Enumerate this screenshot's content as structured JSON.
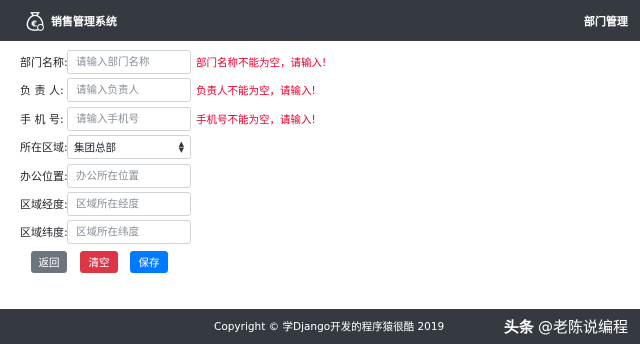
{
  "navbar": {
    "brand_icon": "money-bag-icon",
    "title": "销售管理系统",
    "right_link": "部门管理"
  },
  "form": {
    "fields": [
      {
        "label": "部门名称:",
        "placeholder": "请输入部门名称",
        "error": "部门名称不能为空，请输入!"
      },
      {
        "label": "负 责 人:",
        "placeholder": "请输入负责人",
        "error": "负责人不能为空，请输入!"
      },
      {
        "label": "手 机 号:",
        "placeholder": "请输入手机号",
        "error": "手机号不能为空，请输入!"
      },
      {
        "label": "所在区域:",
        "value": "集团总部"
      },
      {
        "label": "办公位置:",
        "placeholder": "办公所在位置"
      },
      {
        "label": "区域经度:",
        "placeholder": "区域所在经度"
      },
      {
        "label": "区域纬度:",
        "placeholder": "区域所在纬度"
      }
    ]
  },
  "buttons": {
    "back": "返回",
    "clear": "清空",
    "save": "保存"
  },
  "footer": {
    "copyright": "Copyright © 学Django开发的程序猿很酷 2019",
    "watermark_prefix": "头条",
    "watermark_name": "@老陈说编程"
  },
  "colors": {
    "navbar_bg": "#343a40",
    "error_text": "#e6002e",
    "back_button": "#6c757d",
    "clear_button": "#dc3545",
    "save_button": "#007bff"
  }
}
